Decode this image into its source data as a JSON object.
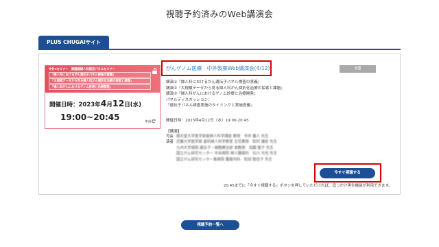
{
  "page": {
    "title": "視聴予約済みのWeb講演会"
  },
  "tab": {
    "label": "PLUS CHUGAIサイト"
  },
  "banner": {
    "series": "中外eセミナー　肺腫瘍婦人科認定パネルセミナー",
    "lines": [
      "「婦人科におけるがん遺伝子パネル検査の意義」",
      "「大規模データから見る婦人科がん個別化治療の探索と課題」",
      "「婦人科がんにおけるゲノム診療と治療開発」"
    ],
    "date_prefix": "開催日時：2023年",
    "date_month": "4",
    "date_month_unit": "月",
    "date_day": "12",
    "date_weekday": "日(水)",
    "time": "19:00~20:45",
    "logo_text": "中外",
    "logo_mark": "e"
  },
  "event": {
    "title": "がんゲノム医療　中外製薬Web講演会(4/12)",
    "badge": "全国",
    "talks": [
      "講演①『婦人科におけるがん遺伝子パネル検査の意義』",
      "講演②『大規模データから見る婦人科がん個別化治療の探索と課題』",
      "講演③『婦人科がんにおけるゲノム診療と治療開発』",
      "パネルディスカッション：",
      "『遺伝子パネル検査実施のタイミングと実施意義』"
    ],
    "held": "開催日時：2023年4月12日（水）19:00-20:45",
    "speakers_heading": "【講演】",
    "speakers": [
      {
        "role": "司会",
        "text": "順天堂大学医学部産婦人科学講座 教授　寺井 義人 先生"
      },
      {
        "role": "演者",
        "text": "近畿大学医学部 産科婦人科学教室 主任教授　松村 謙臣 先生"
      },
      {
        "role": "",
        "text": "九州大学病院 遺伝子・細胞療法部 准教授　加藤 聖子 先生"
      },
      {
        "role": "",
        "text": "国立がん研究センター 中央病院 婦人腫瘍科　石川 光也 先生"
      },
      {
        "role": "",
        "text": "国立がん研究センター東病院 腫瘍内科　松田 智佳子 先生"
      }
    ],
    "watch_label": "今すぐ視聴する",
    "note": "20:45までに「今すぐ視聴する」ボタンを押していただければ、追っかけ再生機能が利用できます。"
  },
  "footer": {
    "list_label": "視聴予約一覧へ"
  },
  "colors": {
    "primary": "#1e4f96",
    "highlight": "#d40000",
    "banner": "#e3505d",
    "link": "#2f7fc6"
  }
}
